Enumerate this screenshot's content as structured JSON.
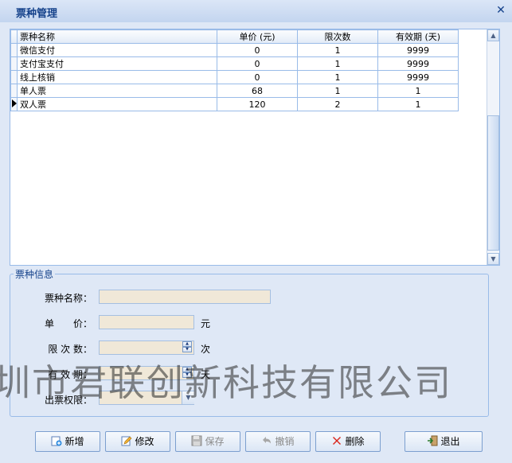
{
  "window": {
    "title": "票种管理"
  },
  "grid": {
    "columns": [
      "票种名称",
      "单价 (元)",
      "限次数",
      "有效期 (天)"
    ],
    "rows": [
      [
        "微信支付",
        "0",
        "1",
        "9999"
      ],
      [
        "支付宝支付",
        "0",
        "1",
        "9999"
      ],
      [
        "线上核销",
        "0",
        "1",
        "9999"
      ],
      [
        "单人票",
        "68",
        "1",
        "1"
      ],
      [
        "双人票",
        "120",
        "2",
        "1"
      ]
    ],
    "current_row": 4
  },
  "form": {
    "legend": "票种信息",
    "name_label": "票种名称：",
    "price_label": "单　　价：",
    "price_unit": "元",
    "limit_label": "限 次 数：",
    "limit_unit": "次",
    "valid_label": "有 效 期：",
    "valid_unit": "天",
    "perm_label": "出票权限：",
    "name_value": "",
    "price_value": "",
    "limit_value": "",
    "valid_value": "",
    "perm_value": ""
  },
  "watermark": "圳市君联创新科技有限公司",
  "buttons": {
    "add": "新增",
    "edit": "修改",
    "save": "保存",
    "undo": "撤销",
    "delete": "删除",
    "exit": "退出"
  },
  "colors": {
    "title_text": "#15428b",
    "border": "#99bbe8",
    "input_bg": "#f0e8d8",
    "delete_icon": "#d9261c"
  }
}
